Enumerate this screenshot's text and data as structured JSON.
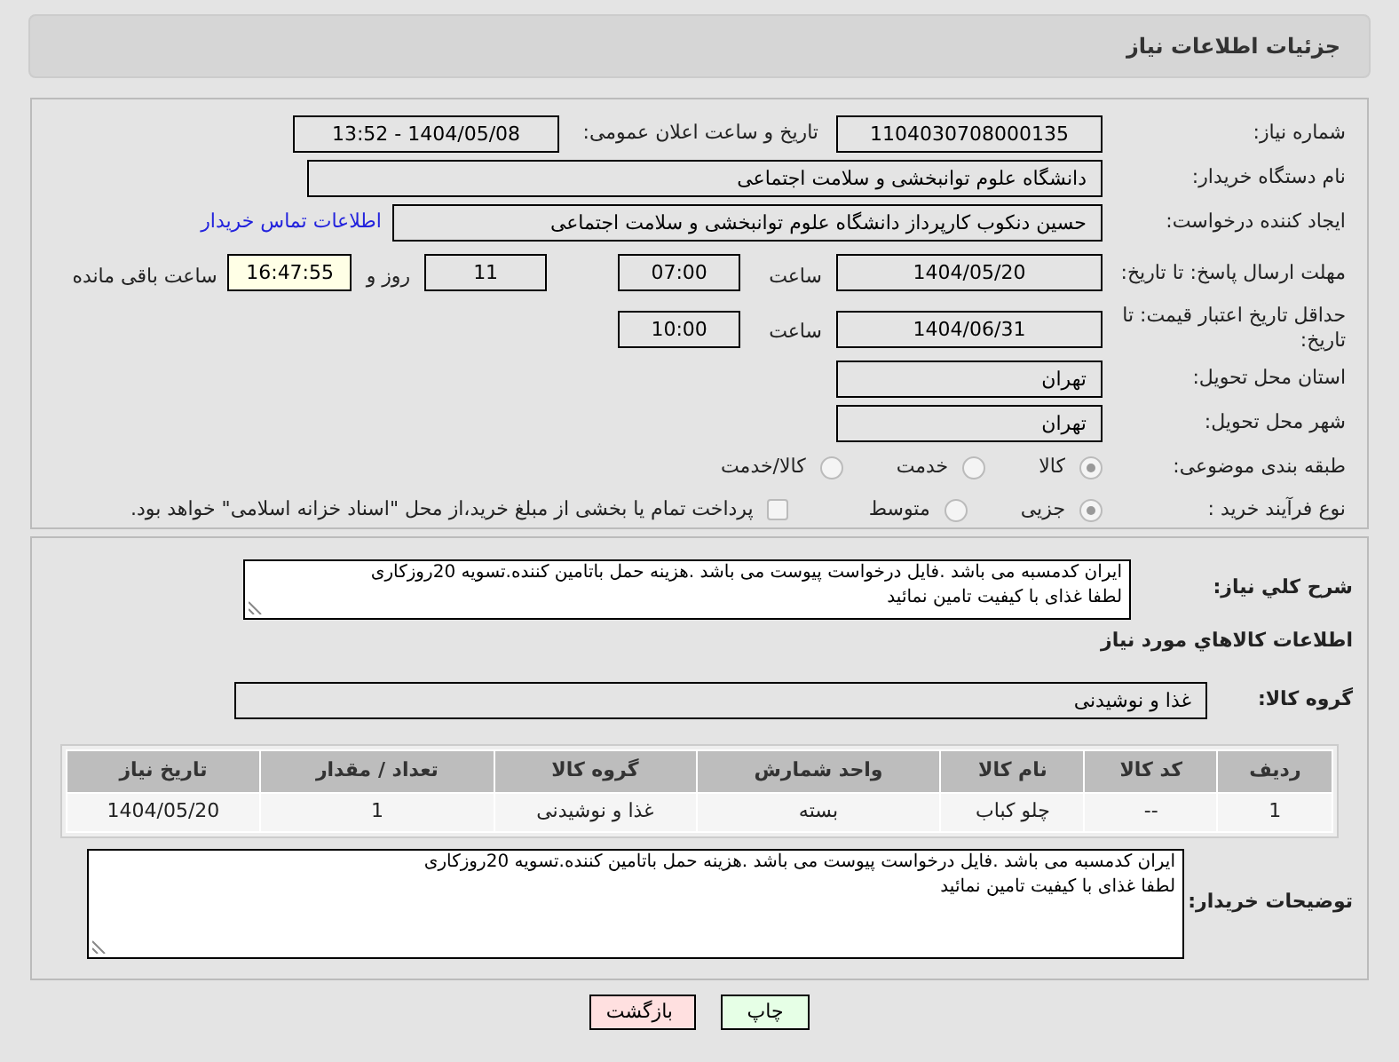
{
  "header": {
    "title": "جزئیات اطلاعات نیاز"
  },
  "form": {
    "need_number": {
      "label": "شماره نیاز:",
      "value": "1104030708000135"
    },
    "announce": {
      "label": "تاریخ و ساعت اعلان عمومی:",
      "value": "1404/05/08 - 13:52"
    },
    "buyer_org": {
      "label": "نام دستگاه خریدار:",
      "value": "دانشگاه علوم توانبخشی و سلامت اجتماعی"
    },
    "creator": {
      "label": "ایجاد کننده درخواست:",
      "value": "حسین دنکوب کارپرداز دانشگاه علوم توانبخشی و سلامت اجتماعی",
      "link": "اطلاعات تماس خریدار"
    },
    "deadline": {
      "label": "مهلت ارسال پاسخ: تا تاریخ:",
      "date": "1404/05/20",
      "time_label": "ساعت",
      "time": "07:00",
      "days": "11",
      "days_label": "روز و",
      "remaining": "16:47:55",
      "remaining_label": "ساعت باقی مانده"
    },
    "validity": {
      "label": "حداقل تاریخ اعتبار قیمت: تا تاریخ:",
      "date": "1404/06/31",
      "time_label": "ساعت",
      "time": "10:00"
    },
    "province": {
      "label": "استان محل تحویل:",
      "value": "تهران"
    },
    "city": {
      "label": "شهر محل تحویل:",
      "value": "تهران"
    },
    "category": {
      "label": "طبقه بندی موضوعی:",
      "options": [
        {
          "label": "کالا",
          "selected": true
        },
        {
          "label": "خدمت",
          "selected": false
        },
        {
          "label": "کالا/خدمت",
          "selected": false
        }
      ]
    },
    "process": {
      "label": "نوع فرآیند خرید :",
      "options": [
        {
          "label": "جزیی",
          "selected": true
        },
        {
          "label": "متوسط",
          "selected": false
        }
      ],
      "treasury": {
        "label": "پرداخت تمام یا بخشی از مبلغ خرید،از محل \"اسناد خزانه اسلامی\" خواهد بود.",
        "checked": false
      }
    }
  },
  "summary": {
    "label": "شرح کلي نياز:",
    "text": "ایران کدمسبه می باشد .فایل درخواست پیوست می باشد .هزینه حمل باتامین کننده.تسویه 20روزکاری\nلطفا غذای با کیفیت تامین نمائید"
  },
  "goods": {
    "title": "اطلاعات کالاهاي مورد نياز",
    "group_label": "گروه کالا:",
    "group": "غذا و نوشیدنی",
    "columns": [
      "ردیف",
      "کد کالا",
      "نام کالا",
      "واحد شمارش",
      "گروه کالا",
      "تعداد / مقدار",
      "تاریخ نیاز"
    ],
    "rows": [
      [
        "1",
        "--",
        "چلو کباب",
        "بسته",
        "غذا و نوشیدنی",
        "1",
        "1404/05/20"
      ]
    ]
  },
  "buyer_notes": {
    "label": "توضیحات خریدار:",
    "text": "ایران کدمسبه می باشد .فایل درخواست پیوست می باشد .هزینه حمل باتامین کننده.تسویه 20روزکاری\nلطفا غذای با کیفیت تامین نمائید"
  },
  "buttons": [
    {
      "label": "چاپ",
      "kind": "print"
    },
    {
      "label": "بازگشت",
      "kind": "back"
    }
  ]
}
